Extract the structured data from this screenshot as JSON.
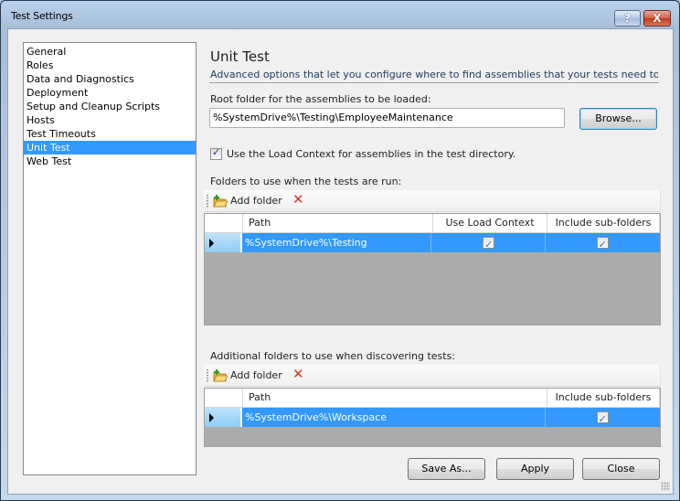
{
  "window": {
    "title": "Test Settings",
    "help_label": "?",
    "close_label": "X"
  },
  "nav": {
    "items": [
      {
        "label": "General",
        "selected": false
      },
      {
        "label": "Roles",
        "selected": false
      },
      {
        "label": "Data and Diagnostics",
        "selected": false
      },
      {
        "label": "Deployment",
        "selected": false
      },
      {
        "label": "Setup and Cleanup Scripts",
        "selected": false
      },
      {
        "label": "Hosts",
        "selected": false
      },
      {
        "label": "Test Timeouts",
        "selected": false
      },
      {
        "label": "Unit Test",
        "selected": true
      },
      {
        "label": "Web Test",
        "selected": false
      }
    ]
  },
  "page": {
    "title": "Unit Test",
    "description": "Advanced options that let you configure where to find assemblies that your tests need to lo...",
    "root_folder_label": "Root folder for the assemblies to be loaded:",
    "root_folder_value": "%SystemDrive%\\Testing\\EmployeeMaintenance",
    "browse_label": "Browse...",
    "load_context_label": "Use the Load Context for assemblies in the test directory.",
    "load_context_checked": true
  },
  "run_folders": {
    "label": "Folders to use when the tests are run:",
    "add_label": "Add folder",
    "columns": [
      "Path",
      "Use Load Context",
      "Include sub-folders"
    ],
    "rows": [
      {
        "path": "%SystemDrive%\\Testing",
        "use_load_context": true,
        "include_subfolders": true
      }
    ]
  },
  "discover_folders": {
    "label": "Additional folders to use when discovering tests:",
    "add_label": "Add folder",
    "columns": [
      "Path",
      "Include sub-folders"
    ],
    "rows": [
      {
        "path": "%SystemDrive%\\Workspace",
        "include_subfolders": true
      }
    ]
  },
  "footer": {
    "save_as_label": "Save As...",
    "apply_label": "Apply",
    "close_label": "Close"
  },
  "colors": {
    "selection": "#3399ff",
    "grid_background": "#ababab",
    "delete_red": "#d8331f"
  }
}
